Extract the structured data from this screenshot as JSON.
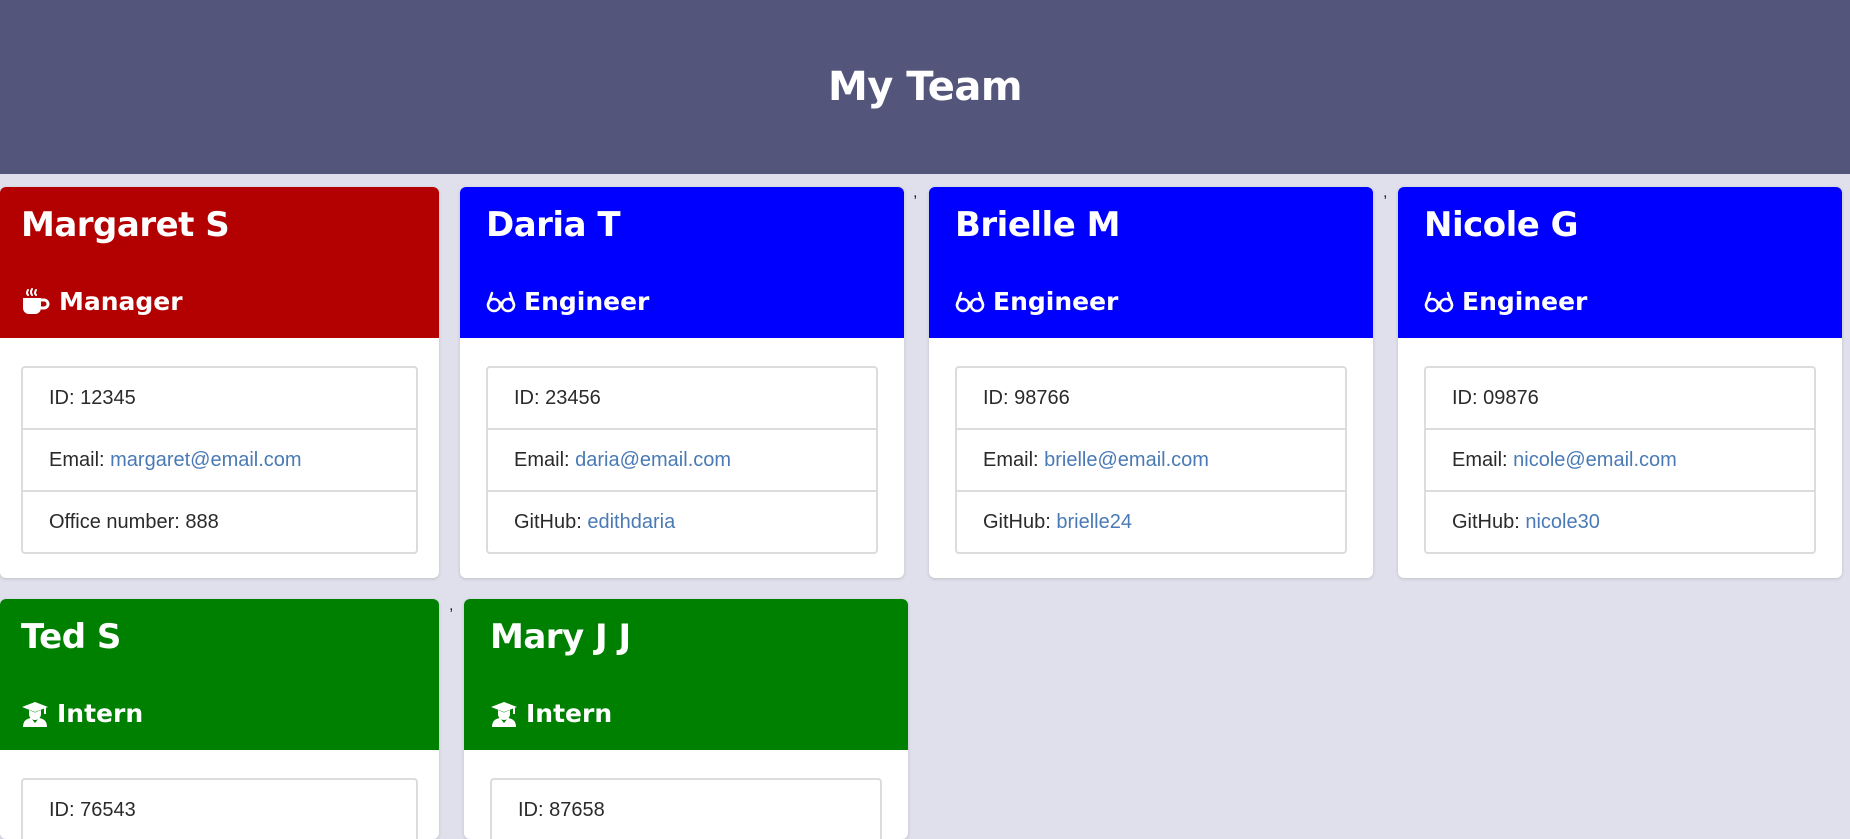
{
  "header": {
    "title": "My Team"
  },
  "separator": ",",
  "colors": {
    "header_bg": "#53557a",
    "page_bg": "#e0e0ec",
    "manager": "#b30000",
    "engineer": "#0000ff",
    "intern": "#008000",
    "link": "#4a7ab5"
  },
  "members": [
    {
      "name": "Margaret S",
      "role": "Manager",
      "role_icon": "coffee-cup-icon",
      "id_label": "ID: ",
      "id": "12345",
      "email_label": "Email: ",
      "email": "margaret@email.com",
      "extra_label": "Office number: ",
      "extra_value": "888"
    },
    {
      "name": "Daria T",
      "role": "Engineer",
      "role_icon": "glasses-icon",
      "id_label": "ID: ",
      "id": "23456",
      "email_label": "Email: ",
      "email": "daria@email.com",
      "extra_label": "GitHub: ",
      "extra_value": "edithdaria"
    },
    {
      "name": "Brielle M",
      "role": "Engineer",
      "role_icon": "glasses-icon",
      "id_label": "ID: ",
      "id": "98766",
      "email_label": "Email: ",
      "email": "brielle@email.com",
      "extra_label": "GitHub: ",
      "extra_value": "brielle24"
    },
    {
      "name": "Nicole G",
      "role": "Engineer",
      "role_icon": "glasses-icon",
      "id_label": "ID: ",
      "id": "09876",
      "email_label": "Email: ",
      "email": "nicole@email.com",
      "extra_label": "GitHub: ",
      "extra_value": "nicole30"
    },
    {
      "name": "Ted S",
      "role": "Intern",
      "role_icon": "graduate-icon",
      "id_label": "ID: ",
      "id": "76543"
    },
    {
      "name": "Mary J J",
      "role": "Intern",
      "role_icon": "graduate-icon",
      "id_label": "ID: ",
      "id": "87658"
    }
  ]
}
